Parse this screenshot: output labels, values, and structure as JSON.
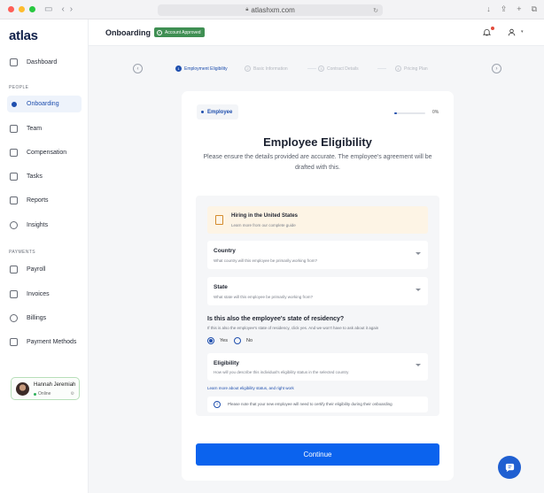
{
  "browser": {
    "url": "atlashxm.com"
  },
  "sidebar": {
    "logo": "atlas",
    "items_top": [
      {
        "label": "Dashboard"
      }
    ],
    "section_people": "PEOPLE",
    "items_people": [
      {
        "label": "Onboarding",
        "active": true
      },
      {
        "label": "Team"
      },
      {
        "label": "Compensation"
      },
      {
        "label": "Tasks"
      },
      {
        "label": "Reports"
      },
      {
        "label": "Insights"
      }
    ],
    "section_payments": "PAYMENTS",
    "items_payments": [
      {
        "label": "Payroll"
      },
      {
        "label": "Invoices"
      },
      {
        "label": "Billings"
      },
      {
        "label": "Payment Methods"
      }
    ],
    "user": {
      "name": "Hannah Jeremiah",
      "status": "Online"
    }
  },
  "header": {
    "title": "Onboarding",
    "badge": "Account Approved",
    "colors": {
      "badge": "#3f8f53",
      "notification_dot": "#e24b3b"
    }
  },
  "stepper": {
    "steps": [
      {
        "num": "1",
        "label": "Employment Eligibility",
        "active": true
      },
      {
        "num": "2",
        "label": "Basic Information"
      },
      {
        "num": "3",
        "label": "Contract Details"
      },
      {
        "num": "4",
        "label": "Pricing Plan"
      }
    ]
  },
  "card": {
    "role": "Employee",
    "progress_label": "0%",
    "title": "Employee Eligibility",
    "subtitle": "Please ensure the details provided are accurate. The employee's agreement will be drafted with this.",
    "info": {
      "title": "Hiring in the United States",
      "subtitle": "Learn more from our complete guide"
    },
    "country": {
      "label": "Country",
      "hint": "What country will this employee be primarily working from?"
    },
    "state": {
      "label": "State",
      "hint": "What state will this employee be primarily working from?"
    },
    "residency": {
      "question": "Is this also the employee's state of residency?",
      "hint": "If this is also the employee's state of residency, click yes. And we won't have to ask about it again",
      "options": [
        {
          "label": "Yes",
          "selected": true
        },
        {
          "label": "No",
          "selected": false
        }
      ]
    },
    "eligibility": {
      "label": "Eligibility",
      "hint": "How will you describe this individual's eligibility status in the selected country"
    },
    "link": "Learn more about eligibility status, and right work",
    "note": "Please note that your new employee will need to certify their eligibility during their onboarding",
    "continue_label": "Continue",
    "colors": {
      "primary": "#0b63ee",
      "accent": "#1f4fae",
      "info_bg": "#fdf4e5"
    }
  }
}
